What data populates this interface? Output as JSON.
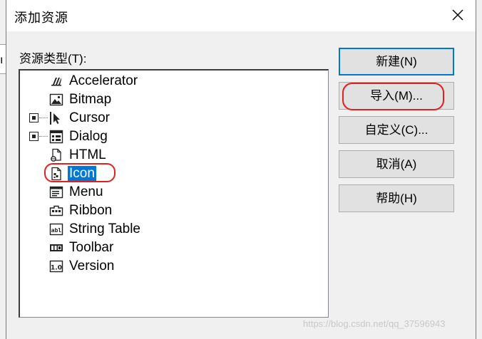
{
  "window": {
    "title": "添加资源",
    "close_glyph": "✕"
  },
  "background": {
    "edge_text": "ı"
  },
  "resource_type": {
    "label": "资源类型(T):",
    "items": [
      {
        "label": "Accelerator",
        "icon": "accelerator-icon",
        "expandable": false,
        "selected": false
      },
      {
        "label": "Bitmap",
        "icon": "bitmap-icon",
        "expandable": false,
        "selected": false
      },
      {
        "label": "Cursor",
        "icon": "cursor-icon",
        "expandable": true,
        "selected": false
      },
      {
        "label": "Dialog",
        "icon": "dialog-icon",
        "expandable": true,
        "selected": false
      },
      {
        "label": "HTML",
        "icon": "html-icon",
        "expandable": false,
        "selected": false
      },
      {
        "label": "Icon",
        "icon": "icon-resource-icon",
        "expandable": false,
        "selected": true
      },
      {
        "label": "Menu",
        "icon": "menu-icon",
        "expandable": false,
        "selected": false
      },
      {
        "label": "Ribbon",
        "icon": "ribbon-icon",
        "expandable": false,
        "selected": false
      },
      {
        "label": "String Table",
        "icon": "string-table-icon",
        "expandable": false,
        "selected": false
      },
      {
        "label": "Toolbar",
        "icon": "toolbar-icon",
        "expandable": false,
        "selected": false
      },
      {
        "label": "Version",
        "icon": "version-icon",
        "expandable": false,
        "selected": false
      }
    ]
  },
  "buttons": {
    "new": "新建(N)",
    "import": "导入(M)...",
    "custom": "自定义(C)...",
    "cancel": "取消(A)",
    "help": "帮助(H)"
  },
  "watermark": "https://blog.csdn.net/qq_37596943",
  "colors": {
    "selection": "#0078d7",
    "annotation": "#e02020",
    "default_button_border": "#0078d7"
  }
}
